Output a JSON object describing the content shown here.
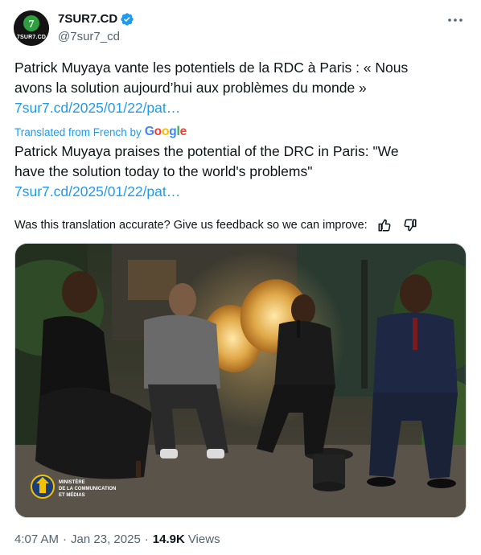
{
  "author": {
    "display_name": "7SUR7.CD",
    "handle": "@7sur7_cd",
    "avatar_text": "7SUR7.CD",
    "verified": true
  },
  "tweet": {
    "text_line1": "Patrick Muyaya vante les potentiels de la RDC à Paris  : « Nous",
    "text_line2": "avons la solution aujourd’hui aux problèmes du monde »",
    "link": "7sur7.cd/2025/01/22/pat…"
  },
  "translation": {
    "label": "Translated from French by",
    "provider": "Google",
    "text_line1": "Patrick Muyaya praises the potential of the DRC in Paris: \"We",
    "text_line2": "have the solution today to the world's problems\"",
    "link": "7sur7.cd/2025/01/22/pat…",
    "feedback_prompt": "Was this translation accurate? Give us feedback so we can improve:"
  },
  "media": {
    "watermark_line1": "MINISTÈRE",
    "watermark_line2": "DE LA COMMUNICATION",
    "watermark_line3": "ET MÉDIAS"
  },
  "meta": {
    "time": "4:07 AM",
    "date": "Jan 23, 2025",
    "views_count": "14.9K",
    "views_label": "Views"
  },
  "colors": {
    "link": "#1d9bf0",
    "verified": "#1d9bf0",
    "secondary_text": "#536471"
  }
}
